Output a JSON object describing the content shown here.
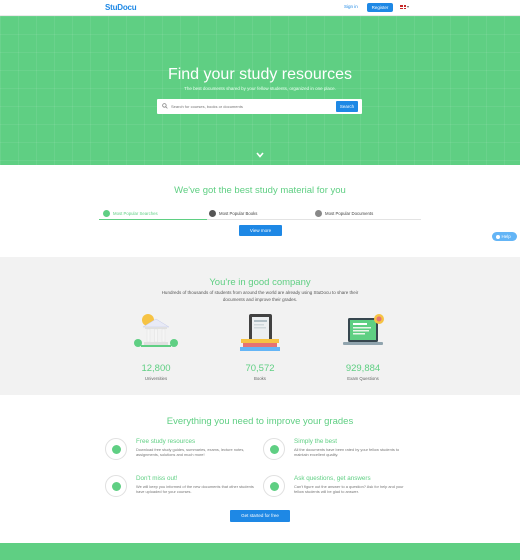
{
  "nav": {
    "logo": "StuDocu",
    "signin_label": "Sign in",
    "register_label": "Register",
    "lang_chevron": "▾"
  },
  "hero": {
    "title": "Find your study resources",
    "subtitle": "The best documents shared by your fellow students, organized in one place.",
    "search_placeholder": "Search for courses, books or documents",
    "search_button": "Search"
  },
  "materials": {
    "title": "We've got the best study material for you",
    "tabs": [
      {
        "label": "Most Popular Searches",
        "active": true
      },
      {
        "label": "Most Popular Books",
        "active": false
      },
      {
        "label": "Most Popular Documents",
        "active": false
      }
    ],
    "view_more_label": "View more"
  },
  "help": {
    "label": "Help"
  },
  "company": {
    "title": "You're in good company",
    "subtitle": "Hundreds of thousands of students from around the world are already using StuDocu to share their documents and improve their grades.",
    "stats": [
      {
        "value": "12,800",
        "label": "Universities",
        "icon": "university-icon"
      },
      {
        "value": "70,572",
        "label": "Books",
        "icon": "books-icon"
      },
      {
        "value": "929,884",
        "label": "Exam Questions",
        "icon": "exam-laptop-icon"
      }
    ]
  },
  "features": {
    "title": "Everything you need to improve your grades",
    "items": [
      {
        "title": "Free study resources",
        "text": "Download free study guides, summaries, exams, lecture notes, assignments, solutions and much more!",
        "icon": "cloud-download-icon"
      },
      {
        "title": "Simply the best",
        "text": "All the documents have been rated by your fellow students to maintain excellent quality.",
        "icon": "star-icon"
      },
      {
        "title": "Don't miss out!",
        "text": "We will keep you informed of the new documents that other students have uploaded for your courses.",
        "icon": "bell-icon"
      },
      {
        "title": "Ask questions, get answers",
        "text": "Can't figure out the answer to a question? Ask for help and your fellow students will be glad to answer.",
        "icon": "question-icon"
      }
    ],
    "cta_label": "Get started for free"
  },
  "colors": {
    "brand_green": "#5fcf83",
    "brand_blue": "#1e88e5"
  }
}
